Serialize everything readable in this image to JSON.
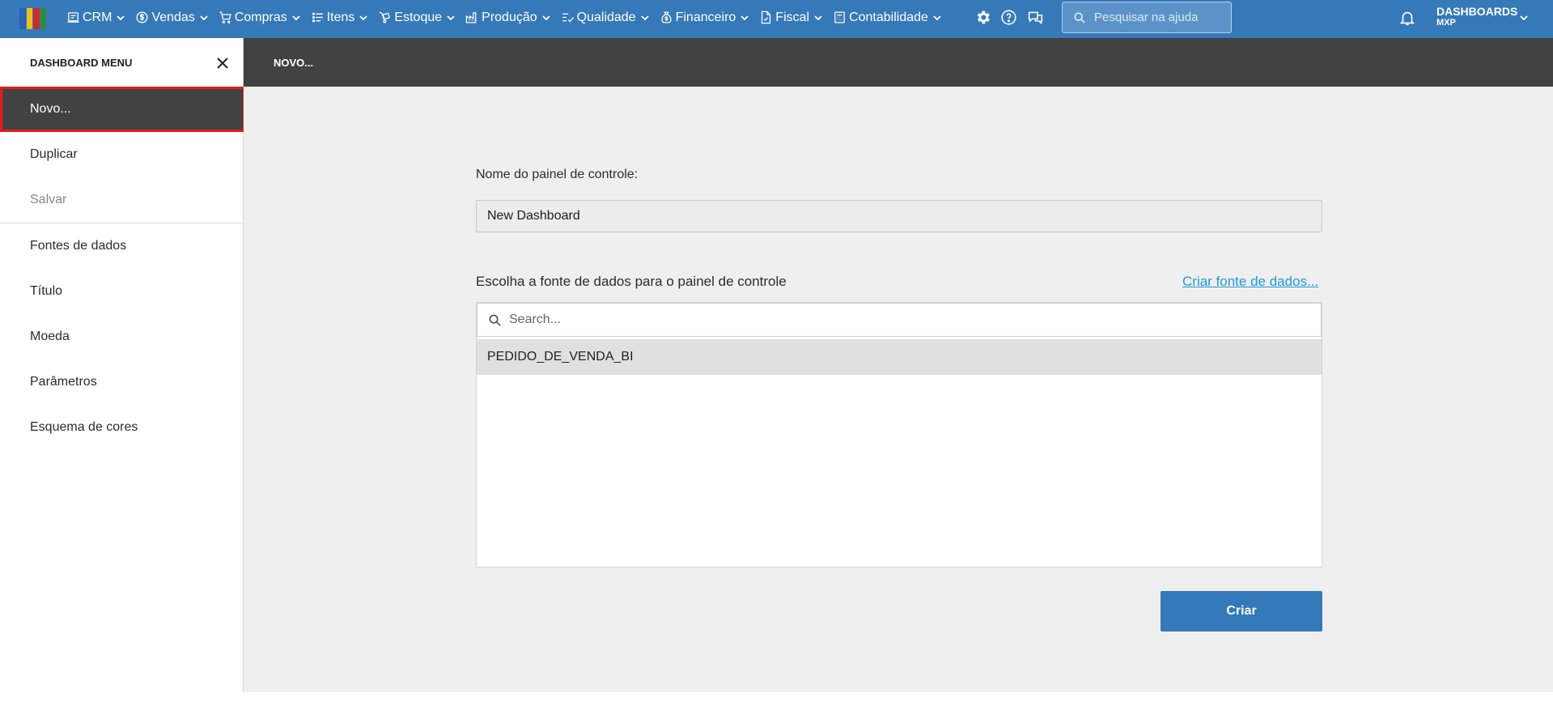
{
  "logo_colors": [
    "#2a62b4",
    "#e9c31c",
    "#cd2a2a",
    "#2f8d3a"
  ],
  "nav": [
    {
      "label": "CRM",
      "icon": "crm-icon"
    },
    {
      "label": "Vendas",
      "icon": "dollar-icon"
    },
    {
      "label": "Compras",
      "icon": "cart-icon"
    },
    {
      "label": "Itens",
      "icon": "items-icon"
    },
    {
      "label": "Estoque",
      "icon": "dolly-icon"
    },
    {
      "label": "Produção",
      "icon": "factory-icon"
    },
    {
      "label": "Qualidade",
      "icon": "checklist-icon"
    },
    {
      "label": "Financeiro",
      "icon": "money-bag-icon"
    },
    {
      "label": "Fiscal",
      "icon": "fiscal-doc-icon"
    },
    {
      "label": "Contabilidade",
      "icon": "calculator-icon"
    }
  ],
  "help_search": {
    "placeholder": "Pesquisar na ajuda"
  },
  "user": {
    "app": "DASHBOARDS",
    "company": "MXP"
  },
  "sidebar": {
    "title": "DASHBOARD MENU",
    "items_top": [
      {
        "label": "Novo...",
        "state": "active"
      },
      {
        "label": "Duplicar",
        "state": "normal"
      },
      {
        "label": "Salvar",
        "state": "disabled"
      }
    ],
    "items_bottom": [
      {
        "label": "Fontes de dados"
      },
      {
        "label": "Título"
      },
      {
        "label": "Moeda"
      },
      {
        "label": "Parâmetros"
      },
      {
        "label": "Esquema de cores"
      }
    ]
  },
  "main": {
    "header": "NOVO...",
    "name_label": "Nome do painel de controle:",
    "name_value": "New Dashboard",
    "datasource_label": "Escolha a fonte de dados para o painel de controle",
    "create_datasource_link": "Criar fonte de dados...",
    "search_placeholder": "Search...",
    "datasources": [
      "PEDIDO_DE_VENDA_BI"
    ],
    "create_button": "Criar"
  },
  "colors": {
    "topbar": "#3579b9",
    "header_dark": "#424242",
    "accent_link": "#1d9ad6",
    "active_outline": "#e8191a",
    "button": "#3479ba"
  }
}
